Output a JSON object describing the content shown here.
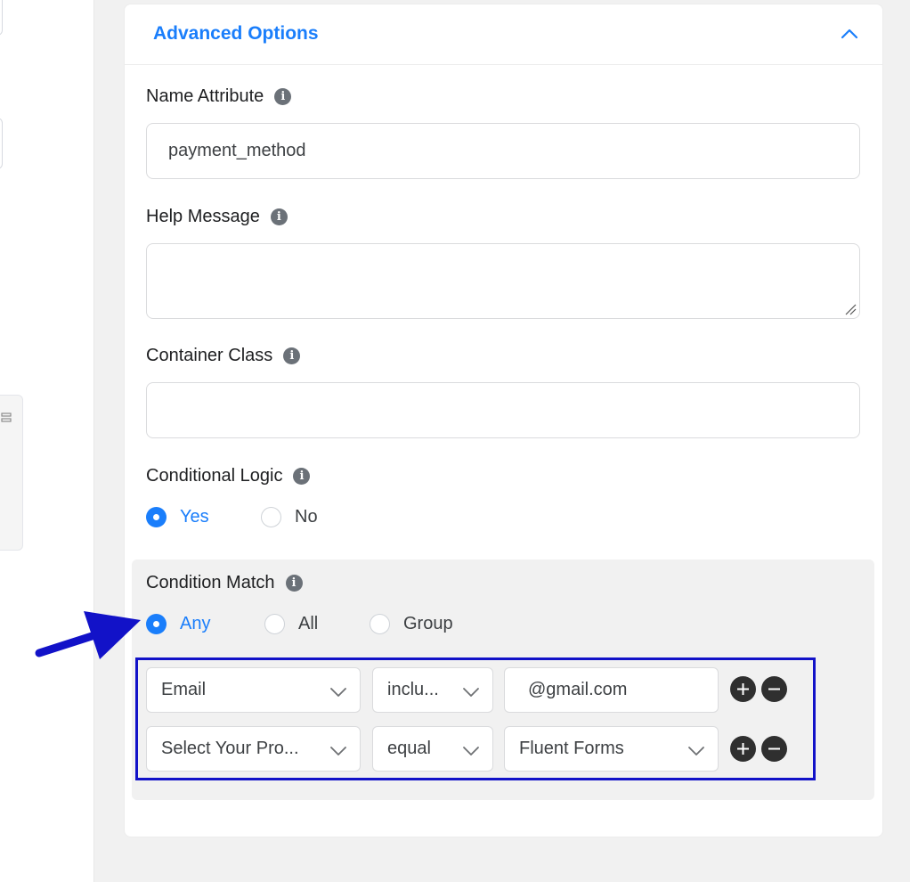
{
  "panel": {
    "title": "Advanced Options"
  },
  "fields": {
    "name_attribute": {
      "label": "Name Attribute",
      "value": "payment_method"
    },
    "help_message": {
      "label": "Help Message",
      "value": ""
    },
    "container_class": {
      "label": "Container Class",
      "value": ""
    }
  },
  "conditional_logic": {
    "label": "Conditional Logic",
    "options": [
      "Yes",
      "No"
    ],
    "selected": "Yes"
  },
  "condition_match": {
    "label": "Condition Match",
    "options": [
      "Any",
      "All",
      "Group"
    ],
    "selected": "Any"
  },
  "rules": [
    {
      "field": "Email",
      "operator": "inclu...",
      "value": "@gmail.com",
      "value_type": "text"
    },
    {
      "field": "Select Your Pro...",
      "operator": "equal",
      "value": "Fluent Forms",
      "value_type": "select"
    }
  ],
  "colors": {
    "accent": "#1a7efb",
    "annotation": "#1212c8"
  }
}
